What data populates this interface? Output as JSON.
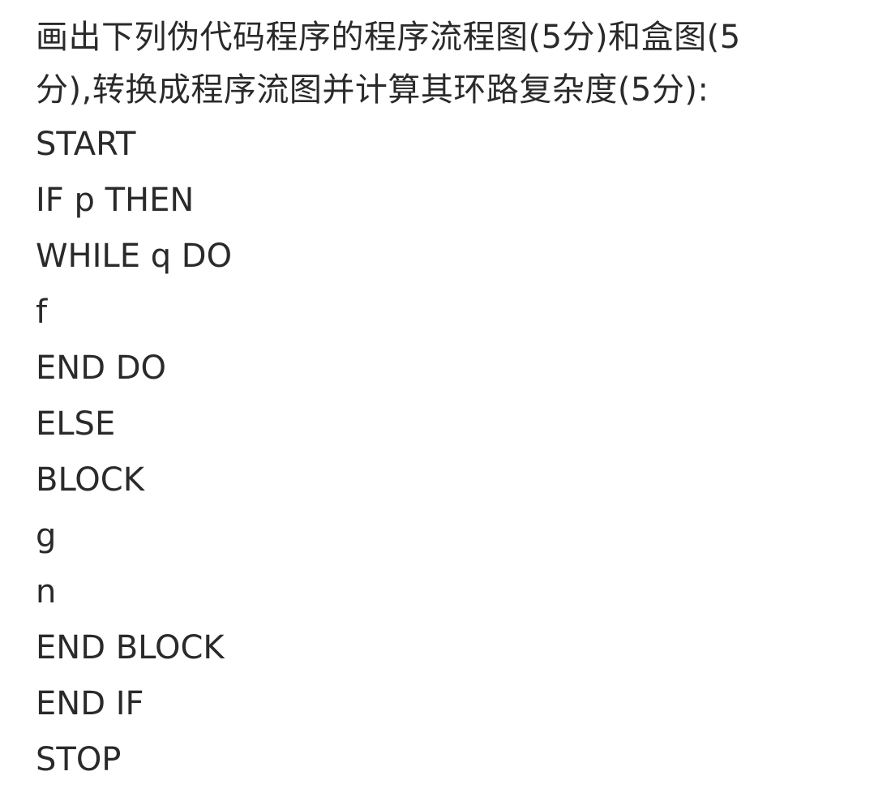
{
  "question": {
    "line1": "画出下列伪代码程序的程序流程图(5分)和盒图(5",
    "line2": "分),转换成程序流图并计算其环路复杂度(5分):"
  },
  "code": [
    "START",
    "IF p THEN",
    "WHILE q DO",
    "f",
    "END DO",
    "ELSE",
    "BLOCK",
    "g",
    "n",
    "END BLOCK",
    "END IF",
    "STOP"
  ]
}
